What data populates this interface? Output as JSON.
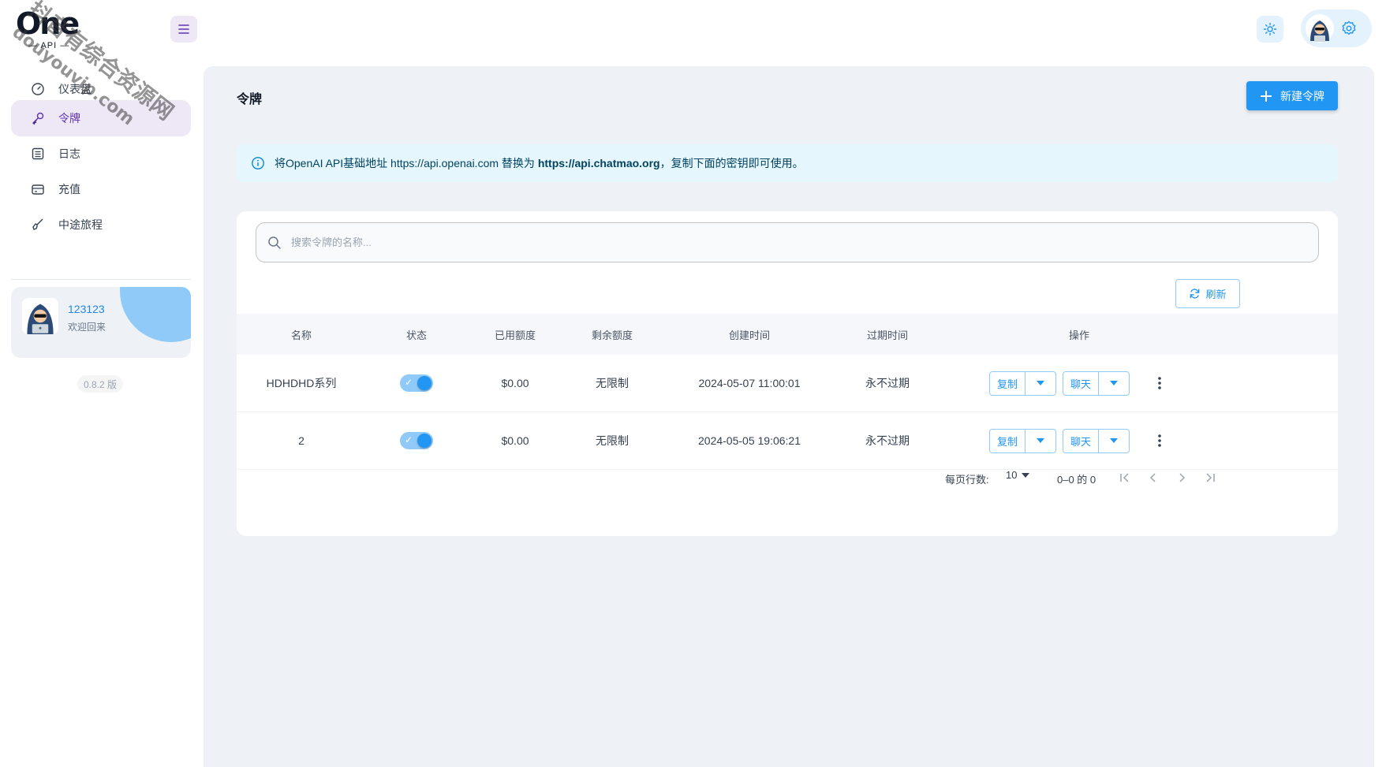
{
  "brand": {
    "logo_text": "One",
    "logo_sub": "— API —"
  },
  "watermark": {
    "line1": "抖音有综合资源网",
    "line2": "douyouvip.com"
  },
  "sidebar": {
    "items": [
      {
        "label": "仪表盘",
        "icon": "dashboard-icon"
      },
      {
        "label": "令牌",
        "icon": "key-icon",
        "active": true
      },
      {
        "label": "日志",
        "icon": "log-icon"
      },
      {
        "label": "充值",
        "icon": "wallet-icon"
      },
      {
        "label": "中途旅程",
        "icon": "brush-icon"
      }
    ],
    "user": {
      "name": "123123",
      "greeting": "欢迎回来"
    },
    "version": "0.8.2 版"
  },
  "main": {
    "title": "令牌",
    "new_button": "新建令牌",
    "alert": {
      "prefix": "将OpenAI API基础地址 https://api.openai.com 替换为 ",
      "url": "https://api.chatmao.org",
      "suffix": "，复制下面的密钥即可使用。"
    },
    "search_placeholder": "搜索令牌的名称...",
    "refresh_label": "刷新",
    "columns": [
      "名称",
      "状态",
      "已用额度",
      "剩余额度",
      "创建时间",
      "过期时间",
      "操作"
    ],
    "rows": [
      {
        "name": "HDHDHD系列",
        "enabled": true,
        "used": "$0.00",
        "remaining": "无限制",
        "created": "2024-05-07 11:00:01",
        "expires": "永不过期",
        "copy_label": "复制",
        "chat_label": "聊天"
      },
      {
        "name": "2",
        "enabled": true,
        "used": "$0.00",
        "remaining": "无限制",
        "created": "2024-05-05 19:06:21",
        "expires": "永不过期",
        "copy_label": "复制",
        "chat_label": "聊天"
      }
    ],
    "pagination": {
      "rows_per_page_label": "每页行数:",
      "rows_per_page": "10",
      "range": "0–0 的 0"
    }
  },
  "colors": {
    "primary": "#2196f3",
    "secondary": "#5e35b1",
    "background": "#eef2f6"
  }
}
